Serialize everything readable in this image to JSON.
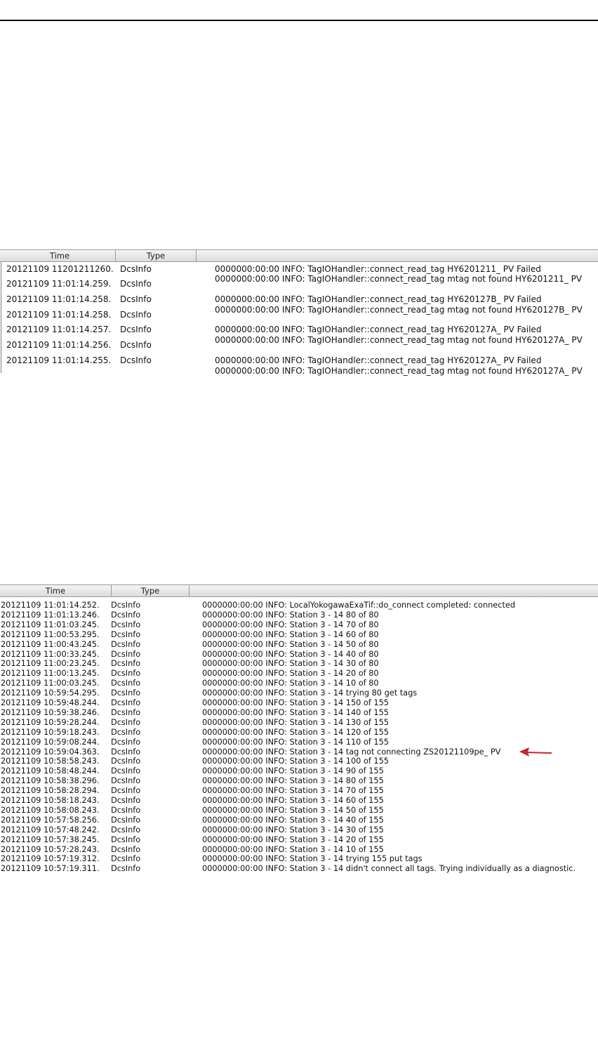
{
  "log_view_1": {
    "columns": [
      "Time",
      "Type",
      ""
    ],
    "rows": [
      {
        "time": "20121109 11201211260.",
        "type": "DcsInfo",
        "message": "0000000:00:00  INFO: TagIOHandler::connect_read_tag HY6201211_ PV Failed",
        "message2": "0000000:00:00  INFO: TagIOHandler::connect_read_tag mtag not found HY6201211_ PV"
      },
      {
        "time": "20121109 11:01:14.259.",
        "type": "DcsInfo",
        "message": "",
        "message2": ""
      },
      {
        "time": "20121109 11:01:14.258.",
        "type": "DcsInfo",
        "message": "0000000:00:00  INFO: TagIOHandler::connect_read_tag HY620127B_ PV Failed",
        "message2": "0000000:00:00  INFO: TagIOHandler::connect_read_tag mtag not found HY620127B_ PV"
      },
      {
        "time": "20121109 11:01:14.258.",
        "type": "DcsInfo",
        "message": "",
        "message2": ""
      },
      {
        "time": "20121109 11:01:14.257.",
        "type": "DcsInfo",
        "message": "0000000:00:00  INFO: TagIOHandler::connect_read_tag HY620127A_ PV Failed",
        "message2": "0000000:00:00  INFO: TagIOHandler::connect_read_tag mtag not found HY620127A_ PV"
      },
      {
        "time": "20121109 11:01:14.256.",
        "type": "DcsInfo",
        "message": "",
        "message2": ""
      },
      {
        "time": "20121109 11:01:14.255.",
        "type": "DcsInfo",
        "message": "0000000:00:00  INFO: TagIOHandler::connect_read_tag HY620127A_ PV Failed",
        "message2": "0000000:00:00  INFO: TagIOHandler::connect_read_tag mtag not found HY620127A_ PV"
      }
    ]
  },
  "log_view_2": {
    "columns": [
      "Time",
      "Type",
      ""
    ],
    "rows": [
      {
        "time": "20121109 11:01:14.252.",
        "type": "DcsInfo",
        "message": "0000000:00:00  INFO: LocalYokogawaExaTif::do_connect completed:  connected"
      },
      {
        "time": "20121109 11:01:13.246.",
        "type": "DcsInfo",
        "message": "0000000:00:00  INFO: Station 3 - 14 80 of 80"
      },
      {
        "time": "20121109 11:01:03.245.",
        "type": "DcsInfo",
        "message": "0000000:00:00  INFO: Station 3 - 14 70 of 80"
      },
      {
        "time": "20121109 11:00:53.295.",
        "type": "DcsInfo",
        "message": "0000000:00:00  INFO: Station 3 - 14 60 of 80"
      },
      {
        "time": "20121109 11:00:43.245.",
        "type": "DcsInfo",
        "message": "0000000:00:00  INFO: Station 3 - 14 50 of 80"
      },
      {
        "time": "20121109 11:00:33.245.",
        "type": "DcsInfo",
        "message": "0000000:00:00  INFO: Station 3 - 14 40 of 80"
      },
      {
        "time": "20121109 11:00:23.245.",
        "type": "DcsInfo",
        "message": "0000000:00:00  INFO: Station 3 - 14 30 of 80"
      },
      {
        "time": "20121109 11:00:13.245.",
        "type": "DcsInfo",
        "message": "0000000:00:00  INFO: Station 3 - 14 20 of 80"
      },
      {
        "time": "20121109 11:00:03.245.",
        "type": "DcsInfo",
        "message": "0000000:00:00  INFO: Station 3 - 14 10 of 80"
      },
      {
        "time": "20121109 10:59:54.295.",
        "type": "DcsInfo",
        "message": "0000000:00:00  INFO: Station 3 - 14 trying 80 get tags"
      },
      {
        "time": "20121109 10:59:48.244.",
        "type": "DcsInfo",
        "message": "0000000:00:00  INFO: Station 3 - 14 150 of 155"
      },
      {
        "time": "20121109 10:59:38.246.",
        "type": "DcsInfo",
        "message": "0000000:00:00  INFO: Station 3 - 14 140 of 155"
      },
      {
        "time": "20121109 10:59:28.244.",
        "type": "DcsInfo",
        "message": "0000000:00:00  INFO: Station 3 - 14 130 of 155"
      },
      {
        "time": "20121109 10:59:18.243.",
        "type": "DcsInfo",
        "message": "0000000:00:00  INFO: Station 3 - 14 120 of 155"
      },
      {
        "time": "20121109 10:59:08.244.",
        "type": "DcsInfo",
        "message": "0000000:00:00  INFO: Station 3 - 14 110 of 155"
      },
      {
        "time": "20121109 10:59:04.363.",
        "type": "DcsInfo",
        "message": "0000000:00:00  INFO: Station 3 - 14 tag not connecting ZS20121109pe_ PV"
      },
      {
        "time": "20121109 10:58:58.243.",
        "type": "DcsInfo",
        "message": "0000000:00:00  INFO: Station 3 - 14 100 of 155"
      },
      {
        "time": "20121109 10:58:48.244.",
        "type": "DcsInfo",
        "message": "0000000:00:00  INFO: Station 3 - 14 90 of 155"
      },
      {
        "time": "20121109 10:58:38.296.",
        "type": "DcsInfo",
        "message": "0000000:00:00  INFO: Station 3 - 14 80 of 155"
      },
      {
        "time": "20121109 10:58:28.294.",
        "type": "DcsInfo",
        "message": "0000000:00:00  INFO: Station 3 - 14 70 of 155"
      },
      {
        "time": "20121109 10:58:18.243.",
        "type": "DcsInfo",
        "message": "0000000:00:00  INFO: Station 3 - 14 60 of 155"
      },
      {
        "time": "20121109 10:58:08.243.",
        "type": "DcsInfo",
        "message": "0000000:00:00  INFO: Station 3 - 14 50 of 155"
      },
      {
        "time": "20121109 10:57:58.256.",
        "type": "DcsInfo",
        "message": "0000000:00:00  INFO: Station 3 - 14 40 of 155"
      },
      {
        "time": "20121109 10:57:48.242.",
        "type": "DcsInfo",
        "message": "0000000:00:00  INFO: Station 3 - 14 30 of 155"
      },
      {
        "time": "20121109 10:57:38.245.",
        "type": "DcsInfo",
        "message": "0000000:00:00  INFO: Station 3 - 14 20 of 155"
      },
      {
        "time": "20121109 10:57:28.243.",
        "type": "DcsInfo",
        "message": "0000000:00:00  INFO: Station 3 - 14 10 of 155"
      },
      {
        "time": "20121109 10:57:19.312.",
        "type": "DcsInfo",
        "message": "0000000:00:00  INFO: Station 3 - 14 trying 155 put tags"
      },
      {
        "time": "20121109 10:57:19.311.",
        "type": "DcsInfo",
        "message": "0000000:00:00  INFO: Station 3 - 14 didn't connect all tags.  Trying individually as a diagnostic."
      }
    ]
  },
  "annotation": {
    "arrow_color": "#c0282d",
    "points_to_row": 15
  }
}
